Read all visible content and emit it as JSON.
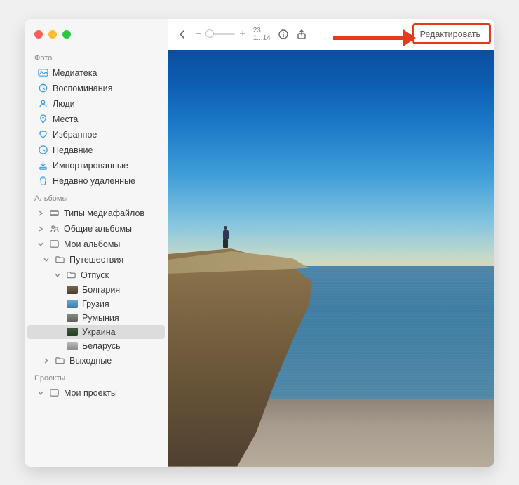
{
  "sidebar": {
    "sections": {
      "photos": {
        "header": "Фото",
        "items": [
          {
            "label": "Медиатека"
          },
          {
            "label": "Воспоминания"
          },
          {
            "label": "Люди"
          },
          {
            "label": "Места"
          },
          {
            "label": "Избранное"
          },
          {
            "label": "Недавние"
          },
          {
            "label": "Импортированные"
          },
          {
            "label": "Недавно удаленные"
          }
        ]
      },
      "albums": {
        "header": "Альбомы",
        "media_types": "Типы медиафайлов",
        "shared": "Общие альбомы",
        "my_albums": "Мои альбомы",
        "travel": "Путешествия",
        "vacation": "Отпуск",
        "bulgaria": "Болгария",
        "georgia": "Грузия",
        "romania": "Румыния",
        "ukraine": "Украина",
        "belarus": "Беларусь",
        "weekends": "Выходные"
      },
      "projects": {
        "header": "Проекты",
        "my_projects": "Мои проекты"
      }
    }
  },
  "toolbar": {
    "counter_top": "23...",
    "counter_bottom": "1...14",
    "edit_label": "Редактировать",
    "zoom_minus": "−",
    "zoom_plus": "+"
  },
  "colors": {
    "highlight": "#e33b1a",
    "accent": "#007aff"
  }
}
